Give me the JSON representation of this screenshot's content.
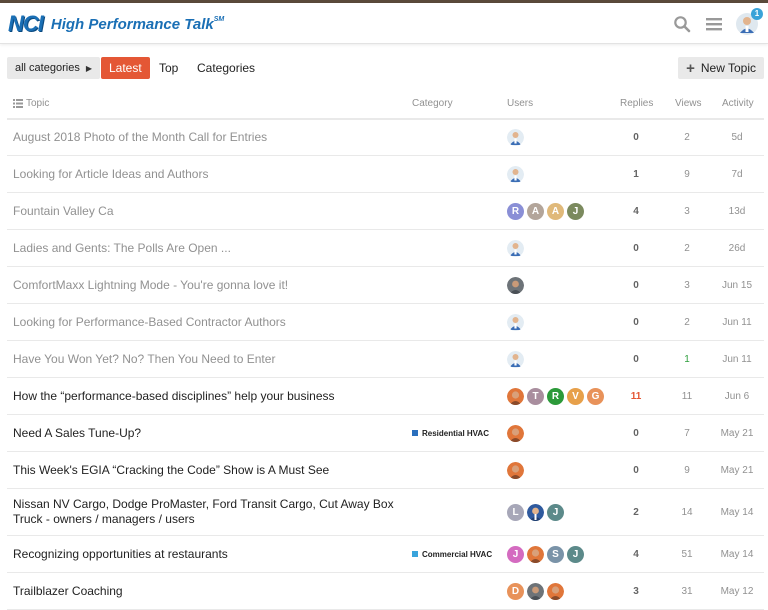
{
  "header": {
    "logo_mark": "NCI",
    "site_title": "High Performance Talk",
    "trademark": "SM",
    "notification_count": "1"
  },
  "nav": {
    "category_dropdown": "all categories",
    "tabs": [
      "Latest",
      "Top",
      "Categories"
    ],
    "active_tab": "Latest",
    "new_topic": "New Topic"
  },
  "columns": {
    "topic": "Topic",
    "category": "Category",
    "users": "Users",
    "replies": "Replies",
    "views": "Views",
    "activity": "Activity"
  },
  "colors": {
    "accent": "#e45735",
    "brand": "#1a6fb5",
    "residential_hvac": "#2a6fbd",
    "commercial_hvac": "#39a4dc"
  },
  "topics": [
    {
      "title": "August 2018 Photo of the Month Call for Entries",
      "read": true,
      "category": "",
      "users": [
        {
          "type": "photo",
          "style": "admin"
        }
      ],
      "replies": "0",
      "views": "2",
      "activity": "5d"
    },
    {
      "title": "Looking for Article Ideas and Authors",
      "read": true,
      "category": "",
      "users": [
        {
          "type": "photo",
          "style": "admin"
        }
      ],
      "replies": "1",
      "views": "9",
      "activity": "7d"
    },
    {
      "title": "Fountain Valley Ca",
      "read": true,
      "category": "",
      "users": [
        {
          "type": "letter",
          "letter": "R",
          "color": "#8a8fd6"
        },
        {
          "type": "letter",
          "letter": "A",
          "color": "#b3a59a"
        },
        {
          "type": "letter",
          "letter": "A",
          "color": "#e0b97a"
        },
        {
          "type": "letter",
          "letter": "J",
          "color": "#7b8a5e"
        }
      ],
      "replies": "4",
      "views": "3",
      "activity": "13d"
    },
    {
      "title": "Ladies and Gents: The Polls Are Open ...",
      "read": true,
      "category": "",
      "users": [
        {
          "type": "photo",
          "style": "admin"
        }
      ],
      "replies": "0",
      "views": "2",
      "activity": "26d"
    },
    {
      "title": "ComfortMaxx Lightning Mode - You're gonna love it!",
      "read": true,
      "category": "",
      "users": [
        {
          "type": "photo",
          "style": "grey"
        }
      ],
      "replies": "0",
      "views": "3",
      "activity": "Jun 15"
    },
    {
      "title": "Looking for Performance-Based Contractor Authors",
      "read": true,
      "category": "",
      "users": [
        {
          "type": "photo",
          "style": "admin"
        }
      ],
      "replies": "0",
      "views": "2",
      "activity": "Jun 11"
    },
    {
      "title": "Have You Won Yet? No? Then You Need to Enter",
      "read": true,
      "category": "",
      "users": [
        {
          "type": "photo",
          "style": "admin"
        }
      ],
      "replies": "0",
      "views": "1",
      "views_green": true,
      "activity": "Jun 11"
    },
    {
      "title": "How the “performance-based disciplines” help your business",
      "read": false,
      "category": "",
      "users": [
        {
          "type": "photo",
          "style": "orange"
        },
        {
          "type": "letter",
          "letter": "T",
          "color": "#a98e9e"
        },
        {
          "type": "letter",
          "letter": "R",
          "color": "#2c9a3a"
        },
        {
          "type": "letter",
          "letter": "V",
          "color": "#e7a04a"
        },
        {
          "type": "letter",
          "letter": "G",
          "color": "#e8925a"
        }
      ],
      "replies": "11",
      "replies_hot": true,
      "views": "11",
      "activity": "Jun 6"
    },
    {
      "title": "Need A Sales Tune-Up?",
      "read": false,
      "category": "Residential HVAC",
      "category_color": "#2a6fbd",
      "users": [
        {
          "type": "photo",
          "style": "orange"
        }
      ],
      "replies": "0",
      "views": "7",
      "activity": "May 21"
    },
    {
      "title": "This Week's EGIA “Cracking the Code” Show is A Must See",
      "read": false,
      "category": "",
      "users": [
        {
          "type": "photo",
          "style": "orange"
        }
      ],
      "replies": "0",
      "views": "9",
      "activity": "May 21"
    },
    {
      "title": "Nissan NV Cargo, Dodge ProMaster, Ford Transit Cargo, Cut Away Box Truck - owners / managers / users",
      "read": false,
      "category": "",
      "users": [
        {
          "type": "letter",
          "letter": "L",
          "color": "#a7a7b8"
        },
        {
          "type": "photo",
          "style": "blue"
        },
        {
          "type": "letter",
          "letter": "J",
          "color": "#5c8a8a"
        }
      ],
      "replies": "2",
      "views": "14",
      "activity": "May 14"
    },
    {
      "title": "Recognizing opportunities at restaurants",
      "read": false,
      "category": "Commercial HVAC",
      "category_color": "#39a4dc",
      "users": [
        {
          "type": "letter",
          "letter": "J",
          "color": "#d46bc0"
        },
        {
          "type": "photo",
          "style": "orange"
        },
        {
          "type": "letter",
          "letter": "S",
          "color": "#7a93a8"
        },
        {
          "type": "letter",
          "letter": "J",
          "color": "#5c8a8a"
        }
      ],
      "replies": "4",
      "views": "51",
      "activity": "May 14"
    },
    {
      "title": "Trailblazer Coaching",
      "read": false,
      "category": "",
      "users": [
        {
          "type": "letter",
          "letter": "D",
          "color": "#e8925a"
        },
        {
          "type": "photo",
          "style": "grey"
        },
        {
          "type": "photo",
          "style": "orange"
        }
      ],
      "replies": "3",
      "views": "31",
      "activity": "May 12"
    }
  ]
}
